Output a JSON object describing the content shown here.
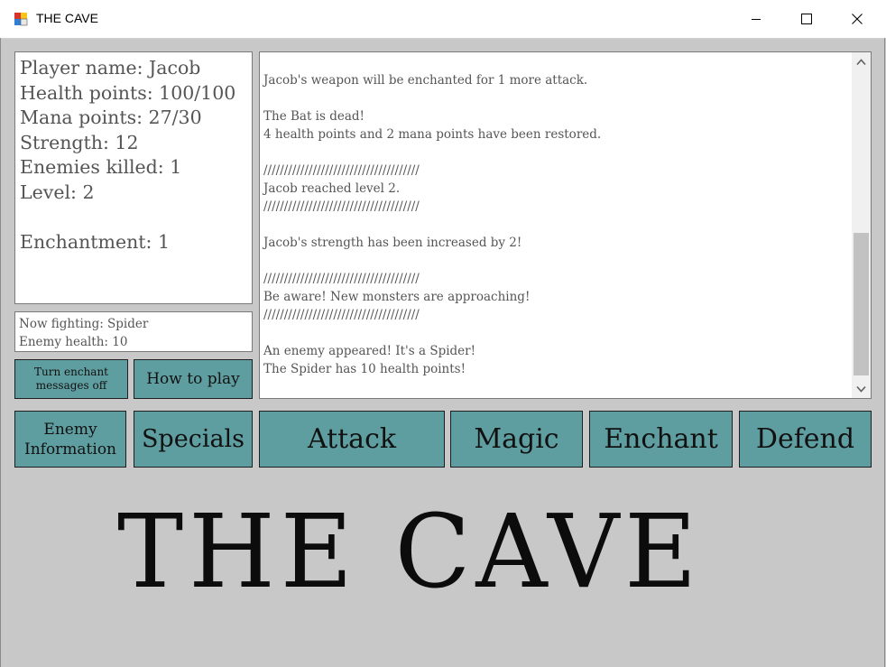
{
  "window": {
    "title": "THE CAVE",
    "minimize_icon": "minimize-icon",
    "maximize_icon": "maximize-icon",
    "close_icon": "close-icon"
  },
  "stats": {
    "player_name": "Player name: Jacob",
    "health": "Health points: 100/100",
    "mana": "Mana points: 27/30",
    "strength": "Strength: 12",
    "enemies_killed": "Enemies killed: 1",
    "level": "Level: 2",
    "enchantment": "Enchantment: 1"
  },
  "fight": {
    "now_fighting": "Now fighting: Spider",
    "enemy_health": "Enemy health: 10"
  },
  "log": {
    "text": "Jacob's weapon will be enchanted for 1 more attack.\n\nThe Bat is dead!\n4 health points and 2 mana points have been restored.\n\n//////////////////////////////////////\nJacob reached level 2.\n//////////////////////////////////////\n\nJacob's strength has been increased by 2!\n\n//////////////////////////////////////\nBe aware! New monsters are approaching!\n//////////////////////////////////////\n\nAn enemy appeared! It's a Spider!\nThe Spider has 10 health points!"
  },
  "buttons": {
    "enchant_messages": "Turn enchant messages off",
    "how_to_play": "How to play",
    "enemy_info": "Enemy Information",
    "specials": "Specials",
    "attack": "Attack",
    "magic": "Magic",
    "enchant": "Enchant",
    "defend": "Defend"
  },
  "logo": "THE CAVE",
  "colors": {
    "button_bg": "#5f9ea0",
    "window_bg": "#c8c8c8"
  }
}
